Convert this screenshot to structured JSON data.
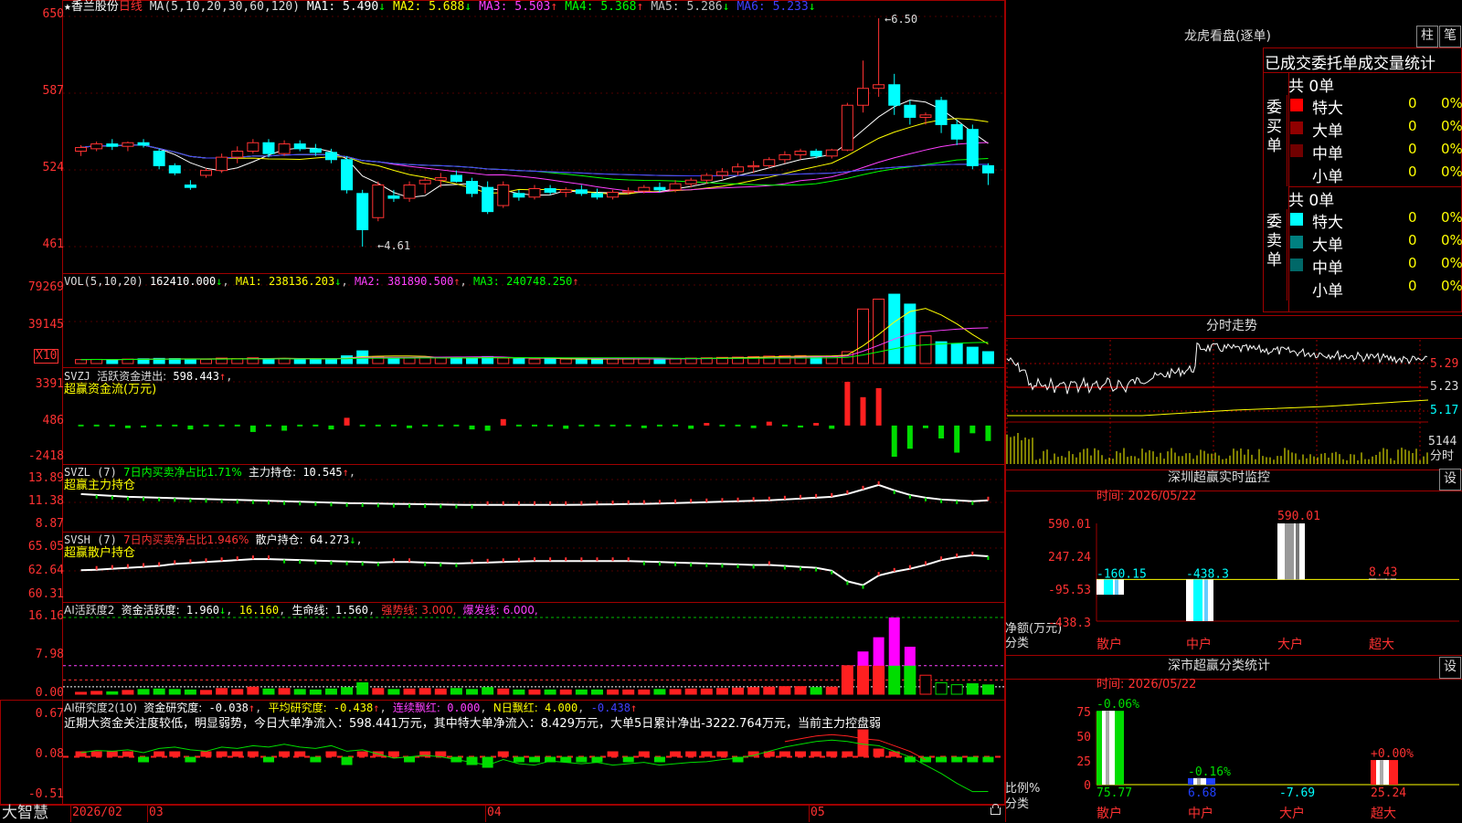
{
  "stock": {
    "star": "★",
    "name": "香兰股份",
    "period": "日线"
  },
  "main_legend": {
    "ma_label": "MA(5,10,20,30,60,120)",
    "items": [
      {
        "label": "MA1:",
        "value": "5.490",
        "arrow": "↓",
        "color": "#ffffff"
      },
      {
        "label": "MA2:",
        "value": "5.688",
        "arrow": "↓",
        "color": "#ffff00"
      },
      {
        "label": "MA3:",
        "value": "5.503",
        "arrow": "↑",
        "color": "#ff40ff"
      },
      {
        "label": "MA4:",
        "value": "5.368",
        "arrow": "↑",
        "color": "#00ff00"
      },
      {
        "label": "MA5:",
        "value": "5.286",
        "arrow": "↓",
        "color": "#c0c0c0"
      },
      {
        "label": "MA6:",
        "value": "5.233",
        "arrow": "↓",
        "color": "#4040ff"
      }
    ],
    "high_mark": "6.50",
    "low_mark": "4.61"
  },
  "main_yticks": [
    "650",
    "587",
    "524",
    "461"
  ],
  "vol": {
    "legend": "VOL(5,10,20)",
    "value": "162410.000",
    "value_arrow": "↓",
    "ma1": "MA1: 238136.203",
    "ma1_arrow": "↓",
    "ma2": "MA2: 381890.500",
    "ma2_arrow": "↑",
    "ma3": "MA3: 240748.250",
    "ma3_arrow": "↑",
    "yticks": [
      "79269",
      "39145"
    ],
    "unit": "X10"
  },
  "svzj": {
    "name": "SVZJ",
    "label": "活跃资金进出:",
    "value": "598.443",
    "arrow": "↑",
    "sep": ",",
    "sub": "超赢资金流(万元)",
    "yticks": [
      "3391",
      "486",
      "-2418"
    ]
  },
  "svzl": {
    "name": "SVZL (7)",
    "label": "7日内买卖净占比1.71%",
    "label2": "主力持仓:",
    "value": "10.545",
    "arrow": "↑",
    "sep": ",",
    "sub": "超赢主力持仓",
    "yticks": [
      "13.89",
      "11.38",
      "8.87"
    ]
  },
  "svsh": {
    "name": "SVSH (7)",
    "label": "7日内买卖净占比1.946%",
    "label2": "散户持仓:",
    "value": "64.273",
    "arrow": "↓",
    "sep": ",",
    "sub": "超赢散户持仓",
    "yticks": [
      "65.05",
      "62.64",
      "60.31"
    ]
  },
  "ai1": {
    "name": "AI活跃度2",
    "label": "资金活跃度:",
    "value": "1.960",
    "arrow": "↓",
    "v2": "16.160",
    "v2sep": ",",
    "life": "生命线:",
    "life_v": "1.560",
    "strong": "强势线: 3.000,",
    "burst": "爆发线: 6.000,",
    "yticks": [
      "16.16",
      "7.98",
      "0.00"
    ]
  },
  "ai2": {
    "name": "AI研究度2(10)",
    "label": "资金研究度:",
    "value": "-0.038",
    "arrow": "↑",
    "avg": "平均研究度:",
    "avg_v": "-0.438",
    "avg_arrow": "↑",
    "lian": "连续飘红:",
    "lian_v": "0.000",
    "n": "N日飘红:",
    "n_v": "4.000",
    "last": "-0.438",
    "last_arrow": "↑",
    "comment": "近期大资金关注度较低，明显弱势，今日大单净流入：598.441万元，其中特大单净流入：8.429万元，大单5日累计净出-3222.764万元，当前主力控盘弱",
    "yticks": [
      "0.67",
      "0.08",
      "-0.51"
    ]
  },
  "xaxis": {
    "brand": "大智慧",
    "labels": [
      "2026/02",
      "03",
      "04",
      "05"
    ]
  },
  "lhb": {
    "title": "龙虎看盘(逐单)",
    "btn1": "柱",
    "btn2": "笔",
    "header": "已成交委托单成交量统计",
    "buy_side": "委买单",
    "sell_side": "委卖单",
    "buy_total": "共 0单",
    "sell_total": "共 0单",
    "buy_rows": [
      {
        "label": "特大",
        "count": "0",
        "pct": "0%",
        "color": "#ff0000"
      },
      {
        "label": "大单",
        "count": "0",
        "pct": "0%",
        "color": "#900000"
      },
      {
        "label": "中单",
        "count": "0",
        "pct": "0%",
        "color": "#700000"
      },
      {
        "label": "小单",
        "count": "0",
        "pct": "0%",
        "color": "#000000"
      }
    ],
    "sell_rows": [
      {
        "label": "特大",
        "count": "0",
        "pct": "0%",
        "color": "#00ffff"
      },
      {
        "label": "大单",
        "count": "0",
        "pct": "0%",
        "color": "#008080"
      },
      {
        "label": "中单",
        "count": "0",
        "pct": "0%",
        "color": "#006868"
      },
      {
        "label": "小单",
        "count": "0",
        "pct": "0%",
        "color": "#000000"
      }
    ]
  },
  "intraday": {
    "title": "分时走势",
    "prices": [
      "5.29",
      "5.23",
      "5.17"
    ],
    "vol_label": "5144",
    "unit": "分时"
  },
  "sz_monitor": {
    "title": "深圳超赢实时监控",
    "btn": "设",
    "time": "时间: 2026/05/22",
    "yticks": [
      "590.01",
      "247.24",
      "-95.53",
      "-438.3"
    ],
    "ylabel": "净额(万元)",
    "xlabel": "分类",
    "bars": [
      {
        "cat": "散户",
        "value": -160.15,
        "label": "-160.15"
      },
      {
        "cat": "中户",
        "value": -438.3,
        "label": "-438.3"
      },
      {
        "cat": "大户",
        "value": 590.01,
        "label": "590.01"
      },
      {
        "cat": "超大",
        "value": 8.43,
        "label": "8.43"
      }
    ]
  },
  "sz_class": {
    "title": "深市超赢分类统计",
    "btn": "设",
    "time": "时间: 2026/05/22",
    "yticks": [
      "75",
      "50",
      "25",
      "0"
    ],
    "ylabel": "比例%",
    "xlabel": "分类",
    "bars": [
      {
        "cat": "散户",
        "value": 75.77,
        "label": "75.77",
        "chg": "-0.06%"
      },
      {
        "cat": "中户",
        "value": 6.68,
        "label": "6.68",
        "chg": "-0.16%"
      },
      {
        "cat": "大户",
        "value": -7.69,
        "label": "-7.69",
        "chg": ""
      },
      {
        "cat": "超大",
        "value": 25.24,
        "label": "25.24",
        "chg": "+0.00%"
      }
    ]
  },
  "chart_data": [
    {
      "type": "candlestick",
      "title": "香兰股份 日线",
      "ylim": [
        4.61,
        6.5
      ],
      "ohlc": [
        [
          5.4,
          5.45,
          5.36,
          5.43
        ],
        [
          5.42,
          5.48,
          5.4,
          5.46
        ],
        [
          5.46,
          5.5,
          5.41,
          5.44
        ],
        [
          5.44,
          5.48,
          5.4,
          5.47
        ],
        [
          5.47,
          5.5,
          5.43,
          5.45
        ],
        [
          5.4,
          5.42,
          5.25,
          5.28
        ],
        [
          5.28,
          5.3,
          5.2,
          5.22
        ],
        [
          5.12,
          5.16,
          5.08,
          5.1
        ],
        [
          5.2,
          5.26,
          5.18,
          5.24
        ],
        [
          5.24,
          5.38,
          5.22,
          5.35
        ],
        [
          5.35,
          5.44,
          5.3,
          5.4
        ],
        [
          5.4,
          5.5,
          5.38,
          5.47
        ],
        [
          5.47,
          5.5,
          5.35,
          5.38
        ],
        [
          5.38,
          5.49,
          5.36,
          5.46
        ],
        [
          5.46,
          5.49,
          5.4,
          5.42
        ],
        [
          5.42,
          5.46,
          5.36,
          5.39
        ],
        [
          5.39,
          5.42,
          5.3,
          5.33
        ],
        [
          5.33,
          5.36,
          5.05,
          5.08
        ],
        [
          5.05,
          5.08,
          4.61,
          4.75
        ],
        [
          4.85,
          5.15,
          4.82,
          5.12
        ],
        [
          5.03,
          5.08,
          4.98,
          5.01
        ],
        [
          5.01,
          5.15,
          4.98,
          5.12
        ],
        [
          5.13,
          5.18,
          5.05,
          5.16
        ],
        [
          5.16,
          5.22,
          5.1,
          5.18
        ],
        [
          5.2,
          5.24,
          5.14,
          5.15
        ],
        [
          5.15,
          5.18,
          5.02,
          5.05
        ],
        [
          5.1,
          5.15,
          4.88,
          4.9
        ],
        [
          4.95,
          5.15,
          4.93,
          5.12
        ],
        [
          5.05,
          5.08,
          4.99,
          5.02
        ],
        [
          5.02,
          5.12,
          5.0,
          5.09
        ],
        [
          5.09,
          5.12,
          5.04,
          5.06
        ],
        [
          5.06,
          5.1,
          5.02,
          5.08
        ],
        [
          5.08,
          5.12,
          5.03,
          5.05
        ],
        [
          5.05,
          5.09,
          5.0,
          5.02
        ],
        [
          5.02,
          5.08,
          5.0,
          5.06
        ],
        [
          5.06,
          5.1,
          5.04,
          5.07
        ],
        [
          5.07,
          5.12,
          5.05,
          5.1
        ],
        [
          5.1,
          5.14,
          5.06,
          5.08
        ],
        [
          5.08,
          5.16,
          5.06,
          5.13
        ],
        [
          5.13,
          5.18,
          5.1,
          5.16
        ],
        [
          5.16,
          5.22,
          5.13,
          5.2
        ],
        [
          5.2,
          5.26,
          5.17,
          5.23
        ],
        [
          5.23,
          5.3,
          5.2,
          5.27
        ],
        [
          5.27,
          5.32,
          5.22,
          5.28
        ],
        [
          5.28,
          5.35,
          5.26,
          5.33
        ],
        [
          5.33,
          5.4,
          5.3,
          5.37
        ],
        [
          5.37,
          5.42,
          5.33,
          5.4
        ],
        [
          5.4,
          5.42,
          5.34,
          5.36
        ],
        [
          5.36,
          5.42,
          5.34,
          5.41
        ],
        [
          5.41,
          5.8,
          5.4,
          5.78
        ],
        [
          5.78,
          6.15,
          5.72,
          5.92
        ],
        [
          5.92,
          6.5,
          5.85,
          5.95
        ],
        [
          5.95,
          6.04,
          5.7,
          5.78
        ],
        [
          5.78,
          5.82,
          5.62,
          5.68
        ],
        [
          5.68,
          5.72,
          5.62,
          5.7
        ],
        [
          5.82,
          5.85,
          5.55,
          5.62
        ],
        [
          5.62,
          5.66,
          5.45,
          5.5
        ],
        [
          5.58,
          5.62,
          5.25,
          5.28
        ],
        [
          5.28,
          5.3,
          5.12,
          5.22
        ]
      ]
    },
    {
      "type": "bar",
      "title": "VOL(5,10,20)",
      "ylim": [
        0,
        79269
      ],
      "values": [
        4000,
        4200,
        3900,
        4500,
        4800,
        5200,
        5000,
        4300,
        4100,
        5500,
        5000,
        5800,
        4900,
        5100,
        4600,
        4400,
        5000,
        7800,
        12800,
        7000,
        5200,
        5500,
        6000,
        5800,
        6000,
        5200,
        7000,
        5600,
        4600,
        4500,
        4700,
        4600,
        4500,
        4400,
        4600,
        4700,
        4800,
        4900,
        5200,
        5500,
        5800,
        6200,
        6500,
        7000,
        7500,
        7800,
        8000,
        7200,
        7500,
        12000,
        55000,
        65000,
        70000,
        60000,
        28000,
        22000,
        20000,
        16500,
        12000
      ],
      "series": [
        {
          "name": "MA1",
          "value": 238136.203
        },
        {
          "name": "MA2",
          "value": 381890.5
        },
        {
          "name": "MA3",
          "value": 240748.25
        }
      ]
    },
    {
      "type": "bar",
      "title": "活跃资金进出",
      "ylim": [
        -2418,
        3391
      ],
      "values": [
        0,
        0,
        0,
        -200,
        -100,
        0,
        0,
        -300,
        0,
        0,
        0,
        -500,
        0,
        -400,
        0,
        0,
        -300,
        600,
        0,
        0,
        0,
        -200,
        0,
        0,
        0,
        -300,
        -400,
        500,
        0,
        0,
        0,
        -250,
        0,
        0,
        0,
        0,
        -200,
        0,
        0,
        -250,
        200,
        0,
        0,
        -200,
        300,
        0,
        -150,
        200,
        -250,
        3391,
        2200,
        2900,
        -2418,
        -1800,
        -200,
        -1000,
        -2100,
        -600,
        -1200
      ]
    },
    {
      "type": "line",
      "title": "SVZL 主力持仓",
      "ylim": [
        8.87,
        13.89
      ],
      "values": [
        12.3,
        12.2,
        12.1,
        12.0,
        11.95,
        11.9,
        11.85,
        11.8,
        11.75,
        11.7,
        11.65,
        11.6,
        11.55,
        11.5,
        11.45,
        11.4,
        11.35,
        11.3,
        11.28,
        11.25,
        11.22,
        11.2,
        11.18,
        11.15,
        11.12,
        11.1,
        11.1,
        11.1,
        11.1,
        11.1,
        11.1,
        11.1,
        11.12,
        11.15,
        11.17,
        11.2,
        11.22,
        11.25,
        11.3,
        11.35,
        11.4,
        11.45,
        11.5,
        11.55,
        11.6,
        11.7,
        11.8,
        11.9,
        12.0,
        12.3,
        12.8,
        13.3,
        12.7,
        12.2,
        11.9,
        11.7,
        11.6,
        11.5,
        11.6
      ]
    },
    {
      "type": "line",
      "title": "SVSH 散户持仓",
      "ylim": [
        60.31,
        65.05
      ],
      "values": [
        62.75,
        62.8,
        62.9,
        63.0,
        63.1,
        63.2,
        63.4,
        63.5,
        63.6,
        63.7,
        63.8,
        63.9,
        63.9,
        63.85,
        63.8,
        63.75,
        63.7,
        63.65,
        63.6,
        63.55,
        63.6,
        63.6,
        63.55,
        63.5,
        63.45,
        63.5,
        63.55,
        63.6,
        63.65,
        63.7,
        63.7,
        63.7,
        63.7,
        63.7,
        63.7,
        63.7,
        63.65,
        63.6,
        63.55,
        63.5,
        63.45,
        63.4,
        63.35,
        63.3,
        63.3,
        63.2,
        63.1,
        63.0,
        62.7,
        61.6,
        61.2,
        62.2,
        62.6,
        62.9,
        63.3,
        63.8,
        64.1,
        64.3,
        64.2
      ]
    },
    {
      "type": "bar",
      "title": "AI活跃度2",
      "ylim": [
        0,
        16.16
      ],
      "values": [
        0.4,
        0.6,
        0.5,
        0.8,
        1.0,
        1.1,
        1.0,
        0.9,
        0.8,
        1.2,
        1.0,
        1.5,
        1.1,
        1.2,
        1.0,
        0.9,
        1.1,
        1.4,
        2.4,
        1.2,
        1.0,
        1.1,
        1.2,
        1.1,
        1.2,
        1.0,
        1.4,
        1.1,
        0.9,
        0.9,
        0.9,
        0.9,
        0.9,
        0.9,
        0.9,
        0.9,
        0.9,
        1.0,
        1.0,
        1.1,
        1.1,
        1.2,
        1.3,
        1.4,
        1.5,
        1.6,
        1.6,
        1.4,
        1.5,
        6.0,
        9.0,
        12.0,
        16.16,
        10.0,
        4.0,
        2.4,
        2.0,
        2.2,
        1.96
      ]
    },
    {
      "type": "bar",
      "title": "AI研究度2",
      "ylim": [
        -0.51,
        0.67
      ],
      "values": [
        0.02,
        0,
        0,
        0.02,
        -0.02,
        0.02,
        0,
        -0.02,
        0,
        0.04,
        0,
        0.02,
        -0.02,
        0.02,
        0,
        -0.02,
        0.02,
        -0.06,
        0.04,
        0,
        0,
        -0.04,
        0,
        0,
        -0.04,
        -0.06,
        -0.08,
        0.02,
        -0.04,
        -0.02,
        -0.04,
        -0.02,
        -0.04,
        -0.02,
        0,
        -0.02,
        0.02,
        -0.02,
        0.02,
        0,
        0,
        0.04,
        -0.02,
        0.04,
        0.02,
        0.02,
        0,
        0.02,
        0.02,
        0.04,
        0.2,
        0.06,
        0.02,
        -0.04,
        -0.02,
        -0.02,
        -0.04,
        -0.02,
        -0.038
      ],
      "series": [
        {
          "name": "平均研究度",
          "value": -0.438
        }
      ]
    }
  ]
}
